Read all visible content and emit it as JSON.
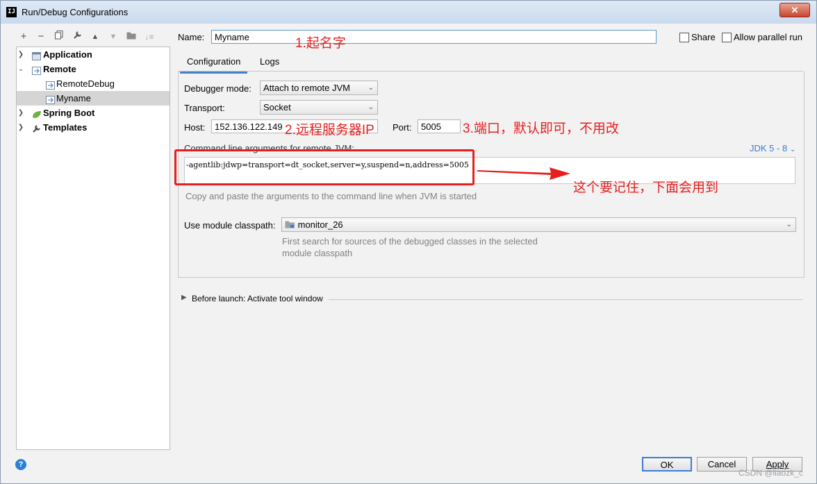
{
  "window": {
    "title": "Run/Debug Configurations",
    "app_icon": "IJ",
    "close_glyph": "✕"
  },
  "toolbar": {
    "icons": [
      "plus-icon",
      "minus-icon",
      "copy-icon",
      "wrench-icon",
      "up-arrow-icon",
      "down-arrow-icon",
      "folder-icon",
      "sort-icon"
    ]
  },
  "tree": {
    "items": [
      {
        "label": "Application",
        "level": 0,
        "expanded": false,
        "bold": true,
        "icon": "application-icon"
      },
      {
        "label": "Remote",
        "level": 0,
        "expanded": true,
        "bold": true,
        "icon": "remote-icon"
      },
      {
        "label": "RemoteDebug",
        "level": 1,
        "bold": false,
        "icon": "remote-config-icon"
      },
      {
        "label": "Myname",
        "level": 1,
        "bold": false,
        "selected": true,
        "icon": "remote-config-icon"
      },
      {
        "label": "Spring Boot",
        "level": 0,
        "expanded": false,
        "bold": true,
        "icon": "spring-boot-icon"
      },
      {
        "label": "Templates",
        "level": 0,
        "expanded": false,
        "bold": true,
        "icon": "wrench-icon"
      }
    ]
  },
  "name_field": {
    "label": "Name:",
    "value": "Myname"
  },
  "share": {
    "label": "Share",
    "checked": false
  },
  "allow_parallel": {
    "label": "Allow parallel run",
    "checked": false
  },
  "tabs": [
    {
      "label": "Configuration",
      "active": true
    },
    {
      "label": "Logs",
      "active": false
    }
  ],
  "debugger_mode": {
    "label": "Debugger mode:",
    "value": "Attach to remote JVM"
  },
  "transport": {
    "label": "Transport:",
    "value": "Socket"
  },
  "host": {
    "label": "Host:",
    "value": "152.136.122.149"
  },
  "port": {
    "label": "Port:",
    "value": "5005"
  },
  "cmd_args": {
    "label": "Command line arguments for remote JVM:",
    "jdk_select": "JDK 5 - 8",
    "value": "-agentlib:jdwp=transport=dt_socket,server=y,suspend=n,address=5005",
    "hint": "Copy and paste the arguments to the command line when JVM is started"
  },
  "module_classpath": {
    "label": "Use module classpath:",
    "value": "monitor_26",
    "hint_line1": "First search for sources of the debugged classes in the selected",
    "hint_line2": "module classpath"
  },
  "before_launch": {
    "label": "Before launch: Activate tool window"
  },
  "buttons": {
    "ok": "OK",
    "cancel": "Cancel",
    "apply": "Apply"
  },
  "help_glyph": "?",
  "annotations": {
    "name": "1.起名字",
    "host": "2.远程服务器IP",
    "port": "3.端口，默认即可，不用改",
    "cmd": "这个要记住，下面会用到"
  },
  "watermark": "CSDN @liaozk_c",
  "colors": {
    "annotation": "#e61e1e",
    "tab_underline": "#4083c9",
    "selection": "#d5d5d5"
  }
}
